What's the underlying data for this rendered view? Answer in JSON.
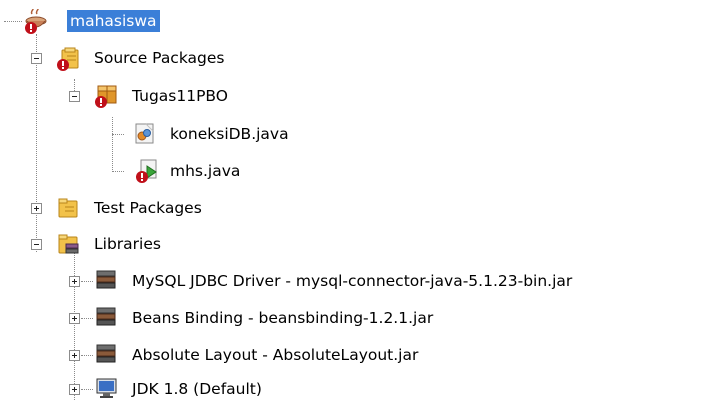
{
  "tree": {
    "project": {
      "label": "mahasiswa"
    },
    "source_packages": {
      "label": "Source Packages"
    },
    "package": {
      "label": "Tugas11PBO"
    },
    "files": [
      {
        "label": "koneksiDB.java"
      },
      {
        "label": "mhs.java"
      }
    ],
    "test_packages": {
      "label": "Test Packages"
    },
    "libraries": {
      "label": "Libraries",
      "items": [
        {
          "label": "MySQL JDBC Driver - mysql-connector-java-5.1.23-bin.jar"
        },
        {
          "label": "Beans Binding - beansbinding-1.2.1.jar"
        },
        {
          "label": "Absolute Layout - AbsoluteLayout.jar"
        },
        {
          "label": "JDK 1.8 (Default)"
        }
      ]
    }
  },
  "colors": {
    "selection": "#3b7fd8",
    "error_badge": "#c0101a",
    "package_orange": "#e0962a"
  }
}
